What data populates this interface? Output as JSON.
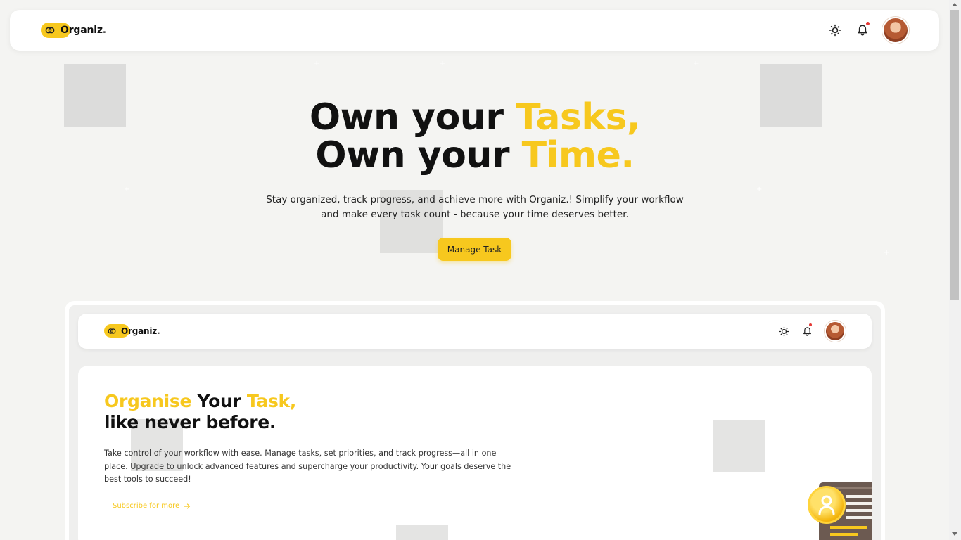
{
  "brand": {
    "name": "Organiz",
    "suffix": "."
  },
  "hero": {
    "title_part1": "Own your ",
    "title_highlight1": "Tasks,",
    "title_part2": " Own your ",
    "title_highlight2": "Time.",
    "subtitle": "Stay organized, track progress, and achieve more with Organiz.! Simplify your workflow and make every task count - because your time deserves better.",
    "button_label": "Manage Task"
  },
  "preview": {
    "brand": {
      "name": "Organiz",
      "suffix": "."
    },
    "card": {
      "title_highlight1": "Organise",
      "title_mid": " Your ",
      "title_highlight2": "Task,",
      "title_line2": "like never before.",
      "text": "Take control of your workflow with ease. Manage tasks, set priorities, and track progress—all in one place. Upgrade to unlock advanced features and supercharge your productivity. Your goals deserve the best tools to succeed!",
      "link_label": "Subscribe for more"
    }
  },
  "icons": {
    "theme": "sun-icon",
    "notifications": "bell-icon",
    "profile": "avatar",
    "link_arrow": "arrow-right-icon"
  },
  "colors": {
    "accent": "#f7c81e",
    "background": "#f4f4f2",
    "notification_dot": "#e53935"
  }
}
